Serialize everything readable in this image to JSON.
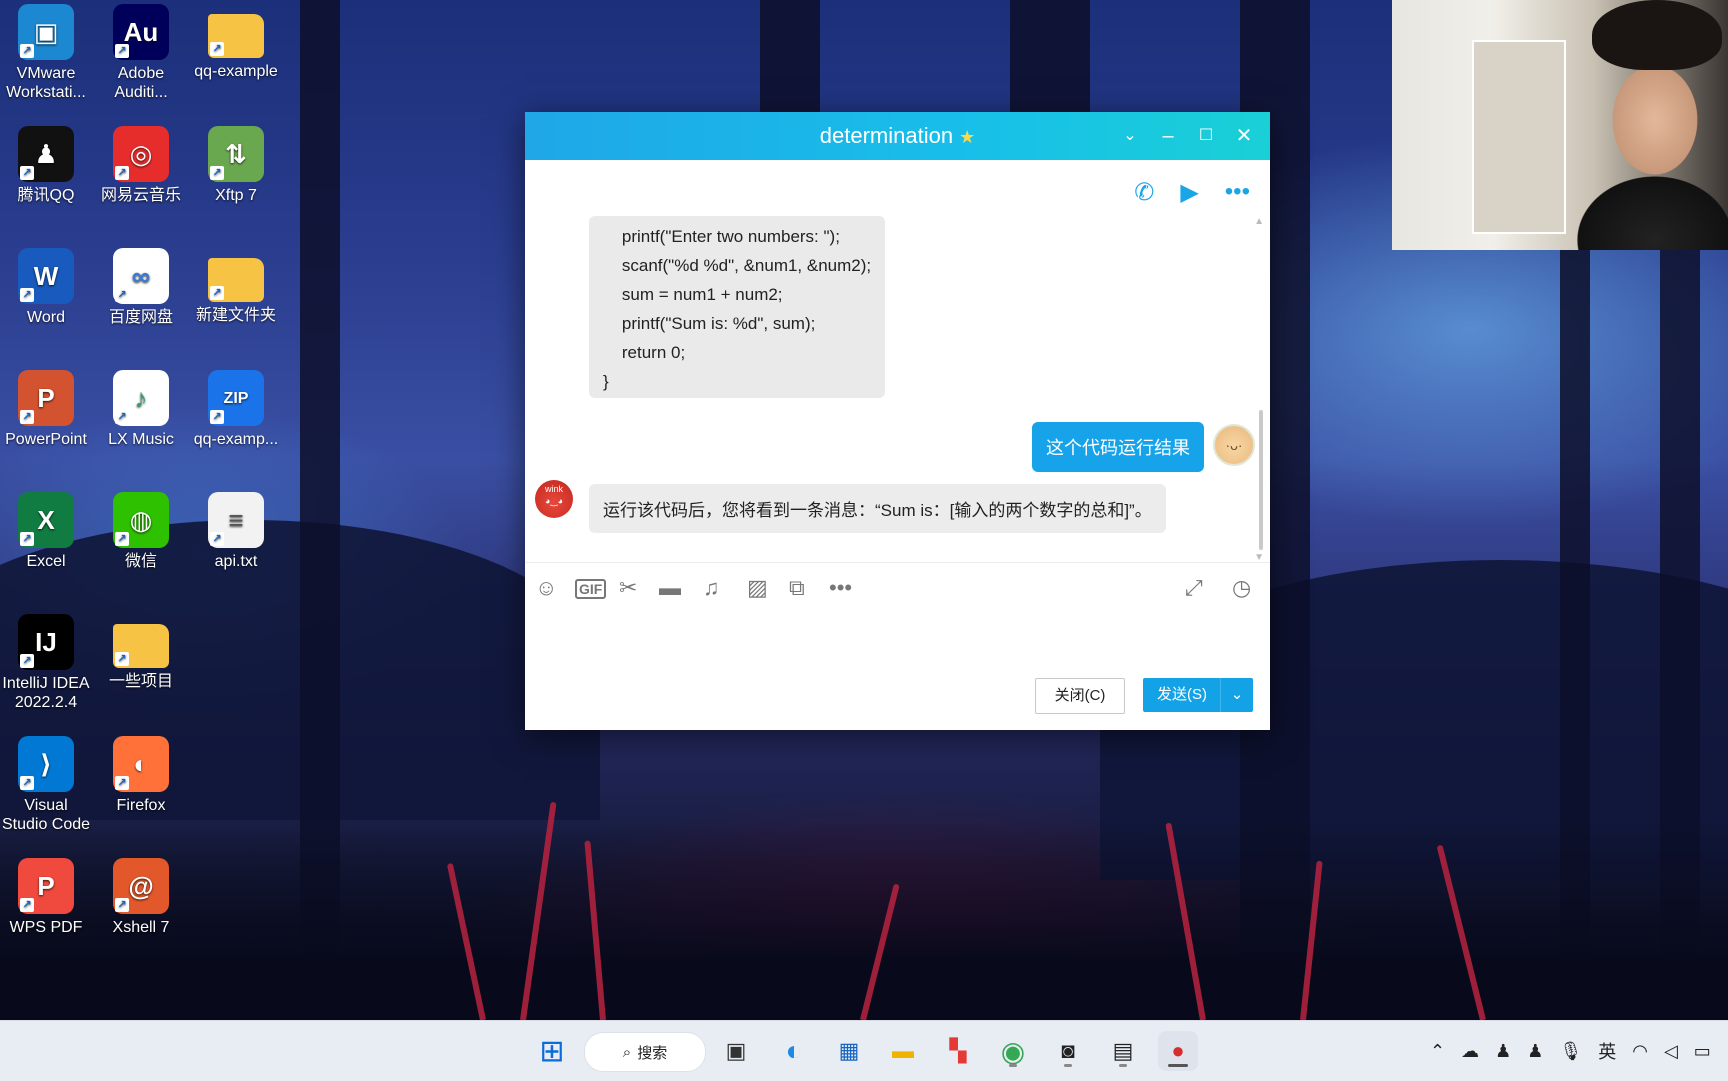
{
  "desktop": {
    "icons": [
      {
        "label": "VMware Workstati...",
        "icon": "vmware-icon",
        "color": "#1b88d1"
      },
      {
        "label": "Adobe Auditi...",
        "icon": "adobe-audition-icon",
        "color": "#00005b"
      },
      {
        "label": "qq-example",
        "icon": "folder-icon",
        "color": "#f6c344"
      },
      {
        "label": "腾讯QQ",
        "icon": "qq-penguin-icon",
        "color": "#111111"
      },
      {
        "label": "网易云音乐",
        "icon": "netease-music-icon",
        "color": "#e72d2c"
      },
      {
        "label": "Xftp 7",
        "icon": "xftp-icon",
        "color": "#6aa84f"
      },
      {
        "label": "Word",
        "icon": "word-icon",
        "color": "#185abd"
      },
      {
        "label": "百度网盘",
        "icon": "baidu-netdisk-icon",
        "color": "#ffffff"
      },
      {
        "label": "新建文件夹",
        "icon": "folder-icon",
        "color": "#f6c344"
      },
      {
        "label": "PowerPoint",
        "icon": "powerpoint-icon",
        "color": "#d35230"
      },
      {
        "label": "LX Music",
        "icon": "lx-music-icon",
        "color": "#ffffff"
      },
      {
        "label": "qq-examp...",
        "icon": "zip-icon",
        "color": "#1a73e8"
      },
      {
        "label": "Excel",
        "icon": "excel-icon",
        "color": "#107c41"
      },
      {
        "label": "微信",
        "icon": "wechat-icon",
        "color": "#2dc100"
      },
      {
        "label": "api.txt",
        "icon": "text-file-icon",
        "color": "#f2f2f2"
      },
      {
        "label": "IntelliJ IDEA 2022.2.4",
        "icon": "intellij-icon",
        "color": "#000000"
      },
      {
        "label": "一些项目",
        "icon": "folder-icon",
        "color": "#f6c344"
      },
      {
        "label": "Visual Studio Code",
        "icon": "vscode-icon",
        "color": "#0078d4"
      },
      {
        "label": "Firefox",
        "icon": "firefox-icon",
        "color": "#ff7139"
      },
      {
        "label": "WPS PDF",
        "icon": "wps-pdf-icon",
        "color": "#ef4a3d"
      },
      {
        "label": "Xshell 7",
        "icon": "xshell-icon",
        "color": "#e2582b"
      }
    ]
  },
  "qq_window": {
    "title": "determination",
    "title_icon": "star-icon",
    "controls": [
      "chevron-down-icon",
      "minimize-icon",
      "maximize-icon",
      "close-icon"
    ],
    "call_actions": [
      "phone-call-icon",
      "video-call-icon",
      "more-icon"
    ],
    "messages": {
      "code_lines": [
        "    printf(\"Enter two numbers: \");",
        "    scanf(\"%d %d\", &num1, &num2);",
        "    sum = num1 + num2;",
        "    printf(\"Sum is: %d\", sum);",
        "    return 0;",
        "}"
      ],
      "outgoing": "这个代码运行结果",
      "incoming": "运行该代码后，您将看到一条消息：“Sum is：[输入的两个数字的总和]”。",
      "bot_avatar_text": "wink"
    },
    "toolbar_icons": [
      "emoji-icon",
      "gif-icon",
      "scissors-icon",
      "folder-icon",
      "music-note-icon",
      "image-icon",
      "screen-record-icon",
      "more-icon"
    ],
    "buttons": {
      "close": "关闭(C)",
      "send": "发送(S)"
    }
  },
  "taskbar": {
    "search_label": "搜索",
    "apps": [
      "windows-start-icon",
      "task-view-icon",
      "edge-icon",
      "store-icon",
      "file-explorer-icon",
      "office-icon",
      "chrome-icon",
      "obs-icon",
      "terminal-icon",
      "qq-chat-icon"
    ],
    "tray": {
      "input_method": "英"
    }
  }
}
